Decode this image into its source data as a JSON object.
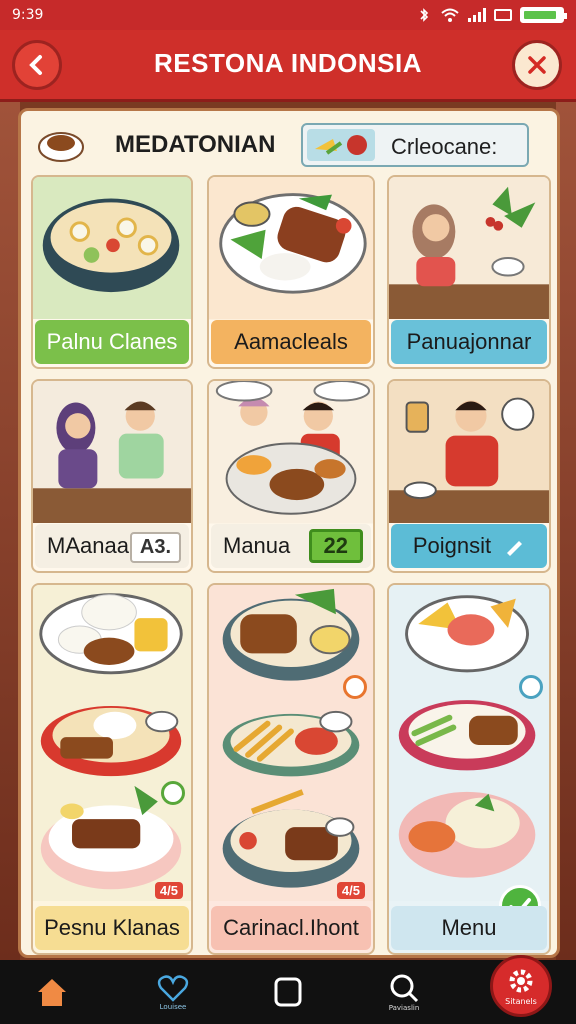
{
  "status_bar": {
    "time": "9:39"
  },
  "header": {
    "title": "RESTONA INDONSIA",
    "back_icon": "chevron-left-icon",
    "close_icon": "close-icon"
  },
  "category": {
    "label": "MEDATONIAN",
    "search_text": "Crleocane:"
  },
  "cards": [
    {
      "label": "Palnu Clanes"
    },
    {
      "label": "Aamacleals"
    },
    {
      "label": "Panuajonnar"
    },
    {
      "label": "MAanaa",
      "badge": "A3."
    },
    {
      "label": "Manua",
      "badge": "22"
    },
    {
      "label": "Poignsit"
    },
    {
      "label": "Pesnu Klanas",
      "badge": "4/5"
    },
    {
      "label": "Carinacl.Ihont",
      "badge": "4/5"
    },
    {
      "label": "Menu"
    }
  ],
  "bottom_nav": {
    "home_icon": "home-icon",
    "favorites_caption": "Louisee",
    "recent_icon": "square-icon",
    "search_caption": "Paviaslin",
    "settings_caption": "Sitanels"
  },
  "colors": {
    "accent": "#cf2f2a",
    "panel": "#fbf3e2",
    "confirm": "#4fb43e"
  }
}
